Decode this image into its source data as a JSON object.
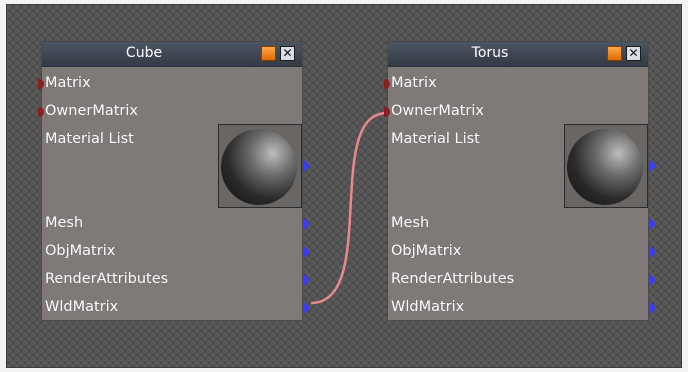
{
  "nodes": [
    {
      "title": "Cube",
      "inputs": [
        "Matrix",
        "OwnerMatrix"
      ],
      "material_label": "Material List",
      "outputs": [
        "Mesh",
        "ObjMatrix",
        "RenderAttributes",
        "WldMatrix"
      ]
    },
    {
      "title": "Torus",
      "inputs": [
        "Matrix",
        "OwnerMatrix"
      ],
      "material_label": "Material List",
      "outputs": [
        "Mesh",
        "ObjMatrix",
        "RenderAttributes",
        "WldMatrix"
      ]
    }
  ],
  "header_buttons": {
    "close_glyph": "✕"
  },
  "connection": {
    "from": "Cube.WldMatrix",
    "to": "Torus.OwnerMatrix",
    "color": "#e88a8a"
  },
  "colors": {
    "input_port": "#8a1f1f",
    "output_port": "#3b3bff",
    "header": "#3a424e",
    "node_body": "#7f7a78"
  },
  "icons": {
    "minimize": "orange-square-icon",
    "close": "close-x-icon",
    "preview": "sphere-material-preview-icon"
  }
}
